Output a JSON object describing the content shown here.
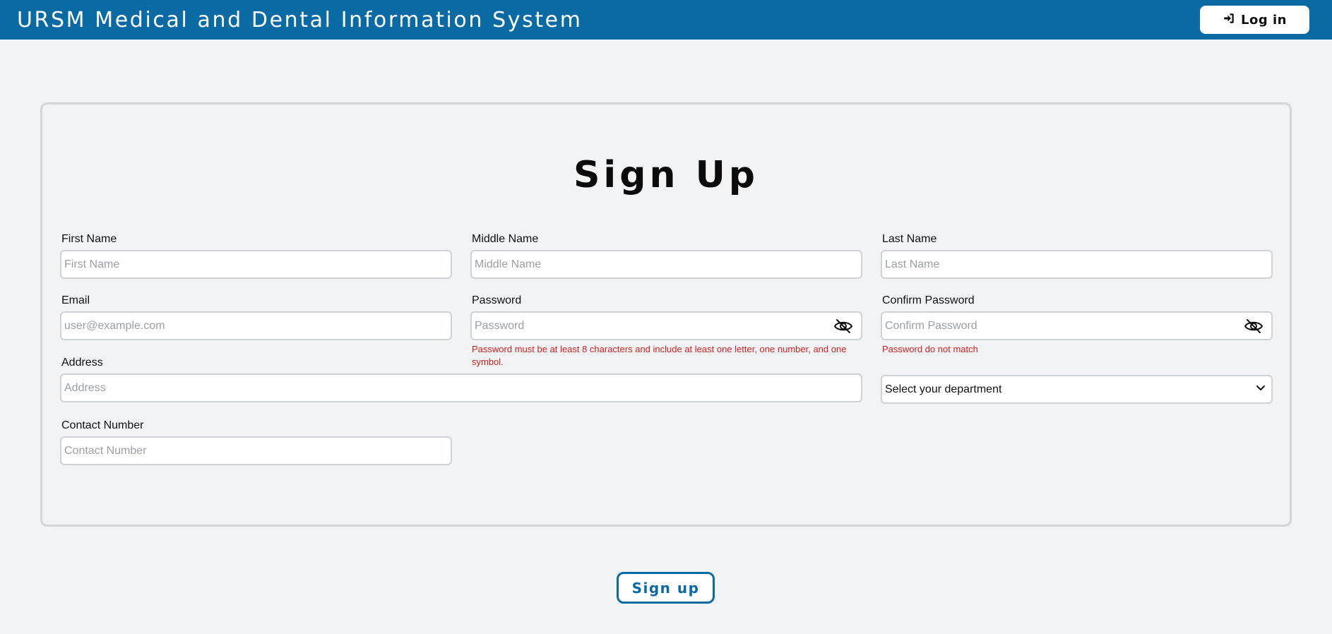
{
  "header": {
    "title": "URSM Medical and Dental Information System",
    "login_label": "Log in"
  },
  "form": {
    "heading": "Sign Up",
    "first_name": {
      "label": "First Name",
      "placeholder": "First Name",
      "value": ""
    },
    "middle_name": {
      "label": "Middle Name",
      "placeholder": "Middle Name",
      "value": ""
    },
    "last_name": {
      "label": "Last Name",
      "placeholder": "Last Name",
      "value": ""
    },
    "email": {
      "label": "Email",
      "placeholder": "user@example.com",
      "value": ""
    },
    "password": {
      "label": "Password",
      "placeholder": "Password",
      "value": "",
      "error": "Password must be at least 8 characters and include at least one letter, one number, and one symbol."
    },
    "confirm_password": {
      "label": "Confirm Password",
      "placeholder": "Confirm Password",
      "value": "",
      "error": "Password do not match"
    },
    "address": {
      "label": "Address",
      "placeholder": "Address",
      "value": ""
    },
    "department": {
      "selected": "Select your department"
    },
    "contact_number": {
      "label": "Contact Number",
      "placeholder": "Contact Number",
      "value": ""
    },
    "submit_label": "Sign up"
  },
  "icons": {
    "login": "login-arrow-icon",
    "password_toggle": "eye-off-icon",
    "dropdown": "chevron-down-icon"
  },
  "colors": {
    "brand": "#0a6aa4",
    "error": "#d3201e",
    "background": "#f2f3f5"
  }
}
